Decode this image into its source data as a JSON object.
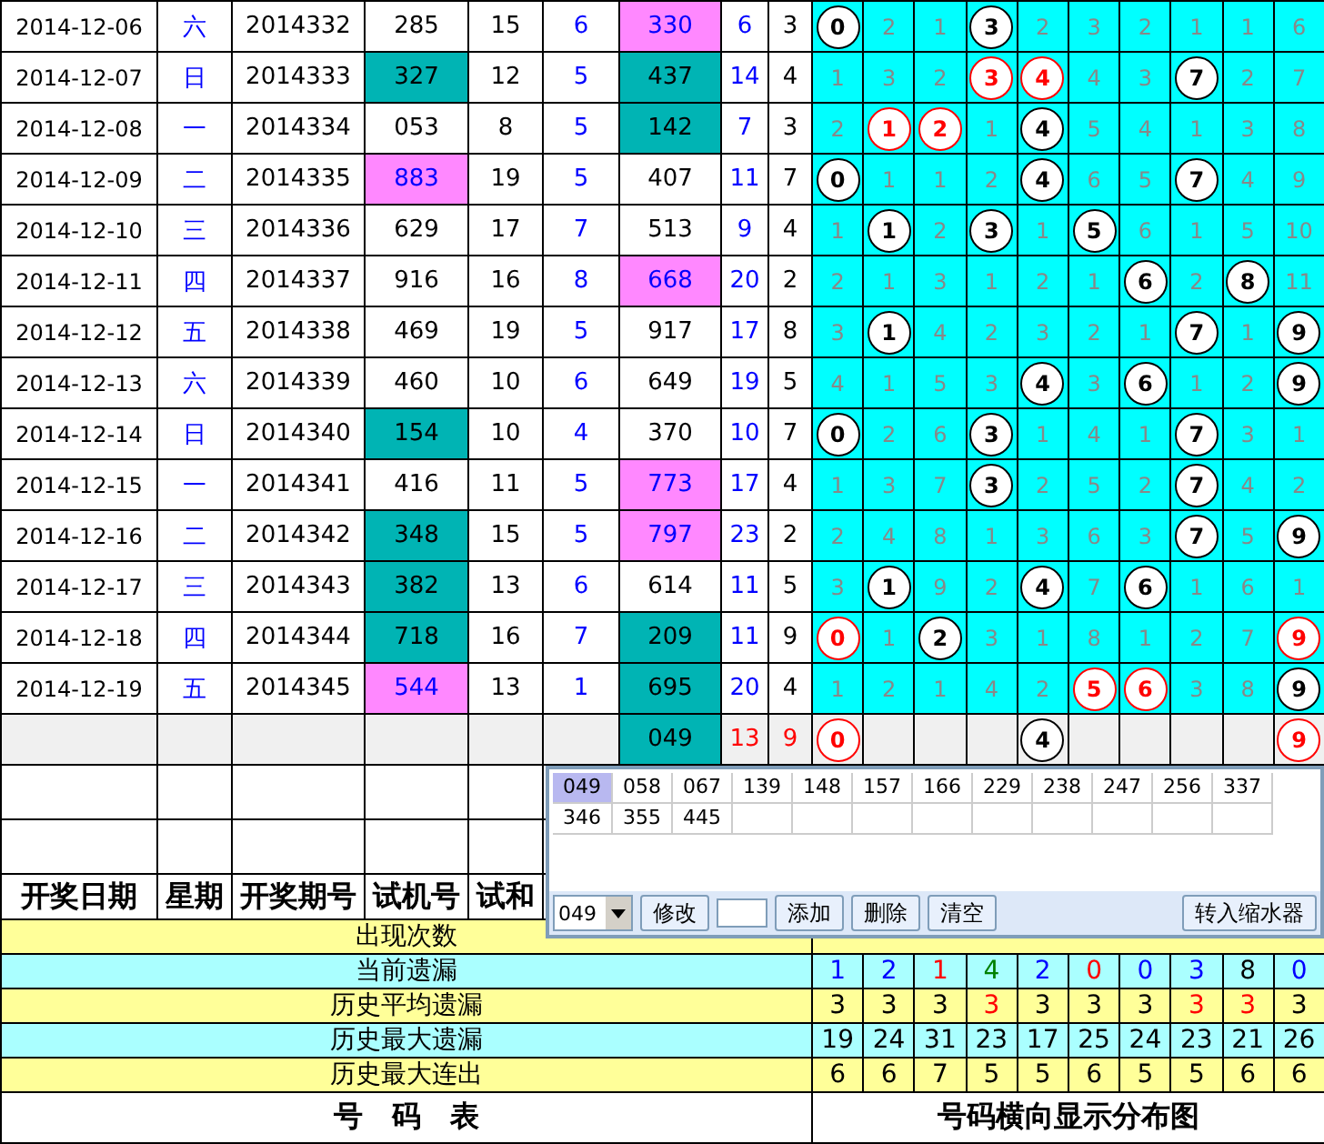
{
  "rows": [
    {
      "date": "2014-12-06",
      "weekday": "六",
      "period": "2014332",
      "test": {
        "text": "285"
      },
      "test_sum": "15",
      "test_span": "6",
      "number": {
        "text": "330",
        "color": "#ff88ff"
      },
      "sum": "6",
      "span": "3",
      "cells": [
        {
          "kind": "hit",
          "text": "0"
        },
        {
          "kind": "miss",
          "text": "2"
        },
        {
          "kind": "miss",
          "text": "1"
        },
        {
          "kind": "hit",
          "text": "3"
        },
        {
          "kind": "miss",
          "text": "2"
        },
        {
          "kind": "miss",
          "text": "3"
        },
        {
          "kind": "miss",
          "text": "2"
        },
        {
          "kind": "miss",
          "text": "1"
        },
        {
          "kind": "miss",
          "text": "1"
        },
        {
          "kind": "miss",
          "text": "6"
        }
      ]
    },
    {
      "date": "2014-12-07",
      "weekday": "日",
      "period": "2014333",
      "test": {
        "text": "327",
        "color": "#00b4b4"
      },
      "test_sum": "12",
      "test_span": "5",
      "number": {
        "text": "437",
        "color": "#00b4b4"
      },
      "sum": "14",
      "span": "4",
      "cells": [
        {
          "kind": "miss",
          "text": "1"
        },
        {
          "kind": "miss",
          "text": "3"
        },
        {
          "kind": "miss",
          "text": "2"
        },
        {
          "kind": "hit-red",
          "text": "3"
        },
        {
          "kind": "hit-red",
          "text": "4"
        },
        {
          "kind": "miss",
          "text": "4"
        },
        {
          "kind": "miss",
          "text": "3"
        },
        {
          "kind": "hit",
          "text": "7"
        },
        {
          "kind": "miss",
          "text": "2"
        },
        {
          "kind": "miss",
          "text": "7"
        }
      ]
    },
    {
      "date": "2014-12-08",
      "weekday": "一",
      "period": "2014334",
      "test": {
        "text": "053"
      },
      "test_sum": "8",
      "test_span": "5",
      "number": {
        "text": "142",
        "color": "#00b4b4"
      },
      "sum": "7",
      "span": "3",
      "cells": [
        {
          "kind": "miss",
          "text": "2"
        },
        {
          "kind": "hit-red",
          "text": "1"
        },
        {
          "kind": "hit-red",
          "text": "2"
        },
        {
          "kind": "miss",
          "text": "1"
        },
        {
          "kind": "hit",
          "text": "4"
        },
        {
          "kind": "miss",
          "text": "5"
        },
        {
          "kind": "miss",
          "text": "4"
        },
        {
          "kind": "miss",
          "text": "1"
        },
        {
          "kind": "miss",
          "text": "3"
        },
        {
          "kind": "miss",
          "text": "8"
        }
      ]
    },
    {
      "date": "2014-12-09",
      "weekday": "二",
      "period": "2014335",
      "test": {
        "text": "883",
        "color": "#ff88ff"
      },
      "test_sum": "19",
      "test_span": "5",
      "number": {
        "text": "407"
      },
      "sum": "11",
      "span": "7",
      "cells": [
        {
          "kind": "hit",
          "text": "0"
        },
        {
          "kind": "miss",
          "text": "1"
        },
        {
          "kind": "miss",
          "text": "1"
        },
        {
          "kind": "miss",
          "text": "2"
        },
        {
          "kind": "hit",
          "text": "4"
        },
        {
          "kind": "miss",
          "text": "6"
        },
        {
          "kind": "miss",
          "text": "5"
        },
        {
          "kind": "hit",
          "text": "7"
        },
        {
          "kind": "miss",
          "text": "4"
        },
        {
          "kind": "miss",
          "text": "9"
        }
      ]
    },
    {
      "date": "2014-12-10",
      "weekday": "三",
      "period": "2014336",
      "test": {
        "text": "629"
      },
      "test_sum": "17",
      "test_span": "7",
      "number": {
        "text": "513"
      },
      "sum": "9",
      "span": "4",
      "cells": [
        {
          "kind": "miss",
          "text": "1"
        },
        {
          "kind": "hit",
          "text": "1"
        },
        {
          "kind": "miss",
          "text": "2"
        },
        {
          "kind": "hit",
          "text": "3"
        },
        {
          "kind": "miss",
          "text": "1"
        },
        {
          "kind": "hit",
          "text": "5"
        },
        {
          "kind": "miss",
          "text": "6"
        },
        {
          "kind": "miss",
          "text": "1"
        },
        {
          "kind": "miss",
          "text": "5"
        },
        {
          "kind": "miss",
          "text": "10"
        }
      ]
    },
    {
      "date": "2014-12-11",
      "weekday": "四",
      "period": "2014337",
      "test": {
        "text": "916"
      },
      "test_sum": "16",
      "test_span": "8",
      "number": {
        "text": "668",
        "color": "#ff88ff"
      },
      "sum": "20",
      "span": "2",
      "cells": [
        {
          "kind": "miss",
          "text": "2"
        },
        {
          "kind": "miss",
          "text": "1"
        },
        {
          "kind": "miss",
          "text": "3"
        },
        {
          "kind": "miss",
          "text": "1"
        },
        {
          "kind": "miss",
          "text": "2"
        },
        {
          "kind": "miss",
          "text": "1"
        },
        {
          "kind": "hit",
          "text": "6"
        },
        {
          "kind": "miss",
          "text": "2"
        },
        {
          "kind": "hit",
          "text": "8"
        },
        {
          "kind": "miss",
          "text": "11"
        }
      ]
    },
    {
      "date": "2014-12-12",
      "weekday": "五",
      "period": "2014338",
      "test": {
        "text": "469"
      },
      "test_sum": "19",
      "test_span": "5",
      "number": {
        "text": "917"
      },
      "sum": "17",
      "span": "8",
      "cells": [
        {
          "kind": "miss",
          "text": "3"
        },
        {
          "kind": "hit",
          "text": "1"
        },
        {
          "kind": "miss",
          "text": "4"
        },
        {
          "kind": "miss",
          "text": "2"
        },
        {
          "kind": "miss",
          "text": "3"
        },
        {
          "kind": "miss",
          "text": "2"
        },
        {
          "kind": "miss",
          "text": "1"
        },
        {
          "kind": "hit",
          "text": "7"
        },
        {
          "kind": "miss",
          "text": "1"
        },
        {
          "kind": "hit",
          "text": "9"
        }
      ]
    },
    {
      "date": "2014-12-13",
      "weekday": "六",
      "period": "2014339",
      "test": {
        "text": "460"
      },
      "test_sum": "10",
      "test_span": "6",
      "number": {
        "text": "649"
      },
      "sum": "19",
      "span": "5",
      "cells": [
        {
          "kind": "miss",
          "text": "4"
        },
        {
          "kind": "miss",
          "text": "1"
        },
        {
          "kind": "miss",
          "text": "5"
        },
        {
          "kind": "miss",
          "text": "3"
        },
        {
          "kind": "hit",
          "text": "4"
        },
        {
          "kind": "miss",
          "text": "3"
        },
        {
          "kind": "hit",
          "text": "6"
        },
        {
          "kind": "miss",
          "text": "1"
        },
        {
          "kind": "miss",
          "text": "2"
        },
        {
          "kind": "hit",
          "text": "9"
        }
      ]
    },
    {
      "date": "2014-12-14",
      "weekday": "日",
      "period": "2014340",
      "test": {
        "text": "154",
        "color": "#00b4b4"
      },
      "test_sum": "10",
      "test_span": "4",
      "number": {
        "text": "370"
      },
      "sum": "10",
      "span": "7",
      "cells": [
        {
          "kind": "hit",
          "text": "0"
        },
        {
          "kind": "miss",
          "text": "2"
        },
        {
          "kind": "miss",
          "text": "6"
        },
        {
          "kind": "hit",
          "text": "3"
        },
        {
          "kind": "miss",
          "text": "1"
        },
        {
          "kind": "miss",
          "text": "4"
        },
        {
          "kind": "miss",
          "text": "1"
        },
        {
          "kind": "hit",
          "text": "7"
        },
        {
          "kind": "miss",
          "text": "3"
        },
        {
          "kind": "miss",
          "text": "1"
        }
      ]
    },
    {
      "date": "2014-12-15",
      "weekday": "一",
      "period": "2014341",
      "test": {
        "text": "416"
      },
      "test_sum": "11",
      "test_span": "5",
      "number": {
        "text": "773",
        "color": "#ff88ff"
      },
      "sum": "17",
      "span": "4",
      "cells": [
        {
          "kind": "miss",
          "text": "1"
        },
        {
          "kind": "miss",
          "text": "3"
        },
        {
          "kind": "miss",
          "text": "7"
        },
        {
          "kind": "hit",
          "text": "3"
        },
        {
          "kind": "miss",
          "text": "2"
        },
        {
          "kind": "miss",
          "text": "5"
        },
        {
          "kind": "miss",
          "text": "2"
        },
        {
          "kind": "hit",
          "text": "7"
        },
        {
          "kind": "miss",
          "text": "4"
        },
        {
          "kind": "miss",
          "text": "2"
        }
      ]
    },
    {
      "date": "2014-12-16",
      "weekday": "二",
      "period": "2014342",
      "test": {
        "text": "348",
        "color": "#00b4b4"
      },
      "test_sum": "15",
      "test_span": "5",
      "number": {
        "text": "797",
        "color": "#ff88ff"
      },
      "sum": "23",
      "span": "2",
      "cells": [
        {
          "kind": "miss",
          "text": "2"
        },
        {
          "kind": "miss",
          "text": "4"
        },
        {
          "kind": "miss",
          "text": "8"
        },
        {
          "kind": "miss",
          "text": "1"
        },
        {
          "kind": "miss",
          "text": "3"
        },
        {
          "kind": "miss",
          "text": "6"
        },
        {
          "kind": "miss",
          "text": "3"
        },
        {
          "kind": "hit",
          "text": "7"
        },
        {
          "kind": "miss",
          "text": "5"
        },
        {
          "kind": "hit",
          "text": "9"
        }
      ]
    },
    {
      "date": "2014-12-17",
      "weekday": "三",
      "period": "2014343",
      "test": {
        "text": "382",
        "color": "#00b4b4"
      },
      "test_sum": "13",
      "test_span": "6",
      "number": {
        "text": "614"
      },
      "sum": "11",
      "span": "5",
      "cells": [
        {
          "kind": "miss",
          "text": "3"
        },
        {
          "kind": "hit",
          "text": "1"
        },
        {
          "kind": "miss",
          "text": "9"
        },
        {
          "kind": "miss",
          "text": "2"
        },
        {
          "kind": "hit",
          "text": "4"
        },
        {
          "kind": "miss",
          "text": "7"
        },
        {
          "kind": "hit",
          "text": "6"
        },
        {
          "kind": "miss",
          "text": "1"
        },
        {
          "kind": "miss",
          "text": "6"
        },
        {
          "kind": "miss",
          "text": "1"
        }
      ]
    },
    {
      "date": "2014-12-18",
      "weekday": "四",
      "period": "2014344",
      "test": {
        "text": "718",
        "color": "#00b4b4"
      },
      "test_sum": "16",
      "test_span": "7",
      "number": {
        "text": "209",
        "color": "#00b4b4"
      },
      "sum": "11",
      "span": "9",
      "cells": [
        {
          "kind": "hit-red",
          "text": "0"
        },
        {
          "kind": "miss",
          "text": "1"
        },
        {
          "kind": "hit",
          "text": "2"
        },
        {
          "kind": "miss",
          "text": "3"
        },
        {
          "kind": "miss",
          "text": "1"
        },
        {
          "kind": "miss",
          "text": "8"
        },
        {
          "kind": "miss",
          "text": "1"
        },
        {
          "kind": "miss",
          "text": "2"
        },
        {
          "kind": "miss",
          "text": "7"
        },
        {
          "kind": "hit-red",
          "text": "9"
        }
      ]
    },
    {
      "date": "2014-12-19",
      "weekday": "五",
      "period": "2014345",
      "test": {
        "text": "544",
        "color": "#ff88ff"
      },
      "test_sum": "13",
      "test_span": "1",
      "number": {
        "text": "695",
        "color": "#00b4b4"
      },
      "sum": "20",
      "span": "4",
      "cells": [
        {
          "kind": "miss",
          "text": "1"
        },
        {
          "kind": "miss",
          "text": "2"
        },
        {
          "kind": "miss",
          "text": "1"
        },
        {
          "kind": "miss",
          "text": "4"
        },
        {
          "kind": "miss",
          "text": "2"
        },
        {
          "kind": "hit-red",
          "text": "5"
        },
        {
          "kind": "hit-red",
          "text": "6"
        },
        {
          "kind": "miss",
          "text": "3"
        },
        {
          "kind": "miss",
          "text": "8"
        },
        {
          "kind": "hit",
          "text": "9"
        }
      ]
    }
  ],
  "pending": {
    "number": {
      "text": "049",
      "color": "#00b4b4"
    },
    "sum": "13",
    "span": "9",
    "cells": [
      {
        "kind": "hit-red",
        "text": "0"
      },
      {
        "kind": "empty"
      },
      {
        "kind": "empty"
      },
      {
        "kind": "empty"
      },
      {
        "kind": "hit",
        "text": "4"
      },
      {
        "kind": "empty"
      },
      {
        "kind": "empty"
      },
      {
        "kind": "empty"
      },
      {
        "kind": "empty"
      },
      {
        "kind": "hit-red",
        "text": "9"
      }
    ]
  },
  "header": [
    "开奖日期",
    "星期",
    "开奖期号",
    "试机号",
    "试和"
  ],
  "stats": [
    {
      "label": "出现次数",
      "kind": "yellow"
    },
    {
      "label": "当前遗漏",
      "kind": "cyan",
      "values": [
        {
          "text": "1",
          "color": "#0000ff"
        },
        {
          "text": "2",
          "color": "#0000ff"
        },
        {
          "text": "1",
          "color": "#ff0000"
        },
        {
          "text": "4",
          "color": "#008000"
        },
        {
          "text": "2",
          "color": "#0000ff"
        },
        {
          "text": "0",
          "color": "#ff0000"
        },
        {
          "text": "0",
          "color": "#0000ff"
        },
        {
          "text": "3",
          "color": "#0000ff"
        },
        {
          "text": "8",
          "color": "#000000"
        },
        {
          "text": "0",
          "color": "#0000ff"
        }
      ]
    },
    {
      "label": "历史平均遗漏",
      "kind": "yellow",
      "values": [
        {
          "text": "3",
          "color": "#000000"
        },
        {
          "text": "3",
          "color": "#000000"
        },
        {
          "text": "3",
          "color": "#000000"
        },
        {
          "text": "3",
          "color": "#ff0000"
        },
        {
          "text": "3",
          "color": "#000000"
        },
        {
          "text": "3",
          "color": "#000000"
        },
        {
          "text": "3",
          "color": "#000000"
        },
        {
          "text": "3",
          "color": "#ff0000"
        },
        {
          "text": "3",
          "color": "#ff0000"
        },
        {
          "text": "3",
          "color": "#000000"
        }
      ]
    },
    {
      "label": "历史最大遗漏",
      "kind": "cyan",
      "values": [
        {
          "text": "19"
        },
        {
          "text": "24"
        },
        {
          "text": "31"
        },
        {
          "text": "23"
        },
        {
          "text": "17"
        },
        {
          "text": "25"
        },
        {
          "text": "24"
        },
        {
          "text": "23"
        },
        {
          "text": "21"
        },
        {
          "text": "26"
        }
      ]
    },
    {
      "label": "历史最大连出",
      "kind": "yellow",
      "values": [
        {
          "text": "6"
        },
        {
          "text": "6"
        },
        {
          "text": "7"
        },
        {
          "text": "5"
        },
        {
          "text": "5"
        },
        {
          "text": "6"
        },
        {
          "text": "5"
        },
        {
          "text": "5"
        },
        {
          "text": "6"
        },
        {
          "text": "6"
        }
      ]
    }
  ],
  "footer": [
    "号　码　表",
    "号码横向显示分布图"
  ],
  "popup": {
    "numbers": [
      {
        "text": "049",
        "selected": true
      },
      {
        "text": "058",
        "selected": false
      },
      {
        "text": "067",
        "selected": false
      },
      {
        "text": "139",
        "selected": false
      },
      {
        "text": "148",
        "selected": false
      },
      {
        "text": "157",
        "selected": false
      },
      {
        "text": "166",
        "selected": false
      },
      {
        "text": "229",
        "selected": false
      },
      {
        "text": "238",
        "selected": false
      },
      {
        "text": "247",
        "selected": false
      },
      {
        "text": "256",
        "selected": false
      },
      {
        "text": "337",
        "selected": false
      },
      {
        "text": "346",
        "selected": false
      },
      {
        "text": "355",
        "selected": false
      },
      {
        "text": "445",
        "selected": false
      }
    ],
    "select_value": "049",
    "edit_button": "修改",
    "buttons": [
      "添加",
      "删除",
      "清空"
    ],
    "convert_button": "转入缩水器"
  }
}
